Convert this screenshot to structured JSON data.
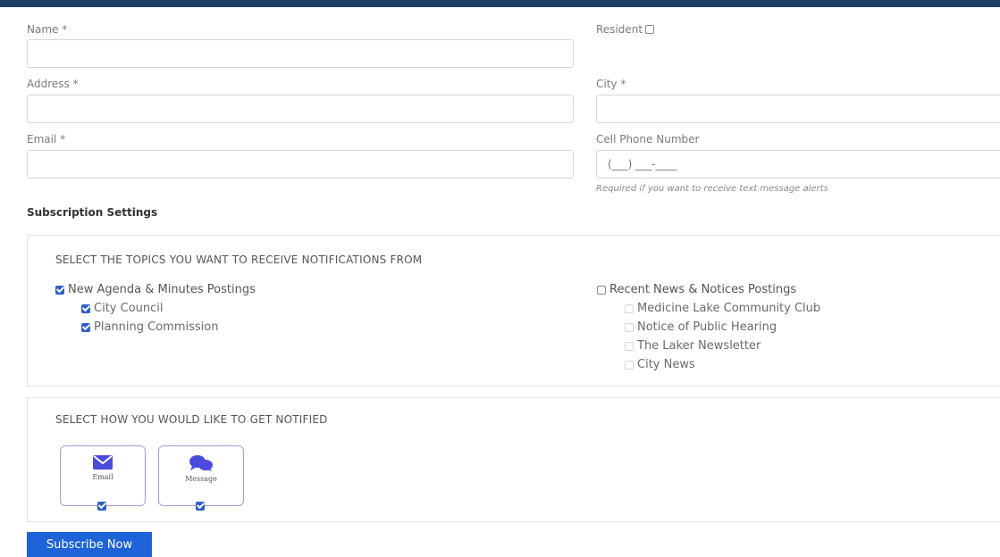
{
  "form": {
    "name_label": "Name *",
    "resident_label": "Resident",
    "address_label": "Address *",
    "city_label": "City *",
    "email_label": "Email *",
    "phone_label": "Cell Phone Number",
    "phone_placeholder": "(___) ___-____",
    "phone_hint": "Required if you want to receive text message alerts"
  },
  "subscription": {
    "title": "Subscription Settings",
    "topics_heading": "SELECT THE TOPICS YOU WANT TO RECEIVE NOTIFICATIONS FROM",
    "left_group": {
      "label": "New Agenda & Minutes Postings",
      "checked": true,
      "items": [
        {
          "label": "City Council",
          "checked": true
        },
        {
          "label": "Planning Commission",
          "checked": true
        }
      ]
    },
    "right_group": {
      "label": "Recent News & Notices Postings",
      "checked": false,
      "items": [
        {
          "label": "Medicine Lake Community Club",
          "checked": false
        },
        {
          "label": "Notice of Public Hearing",
          "checked": false
        },
        {
          "label": "The Laker Newsletter",
          "checked": false
        },
        {
          "label": "City News",
          "checked": false
        }
      ]
    },
    "notify_heading": "SELECT HOW YOU WOULD LIKE TO GET NOTIFIED",
    "methods": [
      {
        "label": "Email",
        "icon": "envelope-icon",
        "checked": true
      },
      {
        "label": "Message",
        "icon": "chat-bubbles-icon",
        "checked": true
      }
    ]
  },
  "submit_label": "Subscribe Now",
  "colors": {
    "accent": "#2f5fc7",
    "button": "#1f63d8",
    "topbar": "#1f3f68"
  }
}
